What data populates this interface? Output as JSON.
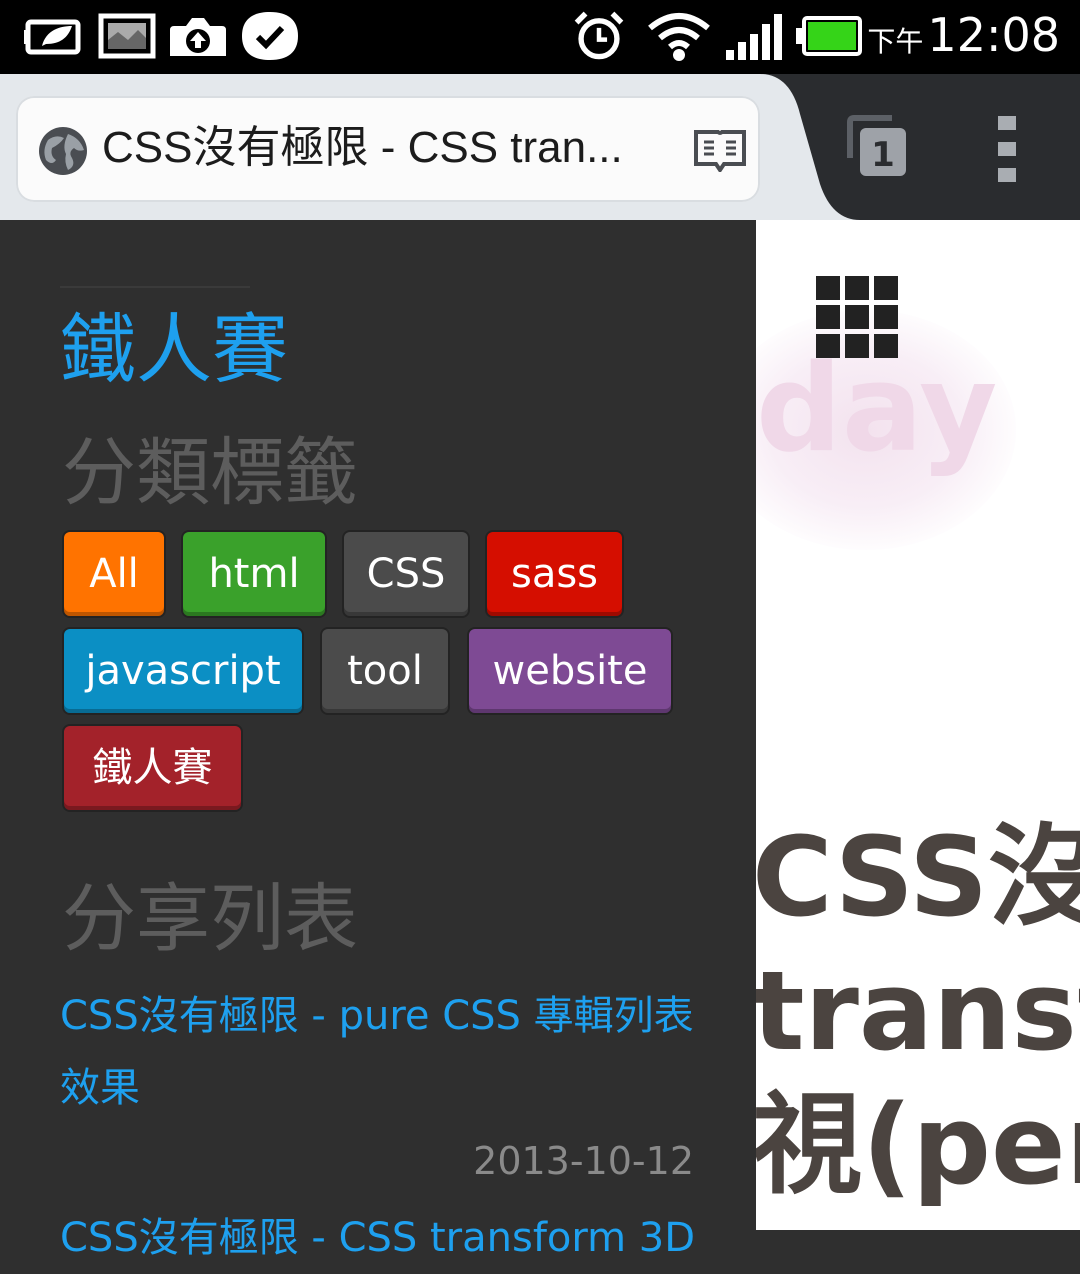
{
  "status_bar": {
    "icons": [
      "battery-saver-icon",
      "gallery-icon",
      "upload-icon",
      "task-check-icon",
      "alarm-icon",
      "wifi-icon",
      "signal-icon",
      "battery-icon"
    ],
    "ampm": "下午",
    "time": "12:08"
  },
  "browser": {
    "page_title": "CSS沒有極限 - CSS tran...",
    "tab_count": "1"
  },
  "sidebar": {
    "heading": "鐵人賽",
    "categories_title": "分類標籤",
    "tags": [
      {
        "label": "All",
        "color": "#ff7300"
      },
      {
        "label": "html",
        "color": "#3aa12b"
      },
      {
        "label": "CSS",
        "color": "#4b4b4b"
      },
      {
        "label": "sass",
        "color": "#d50e00"
      },
      {
        "label": "javascript",
        "color": "#0b8fc4"
      },
      {
        "label": "tool",
        "color": "#4b4b4b"
      },
      {
        "label": "website",
        "color": "#7e4a94"
      },
      {
        "label": "鐵人賽",
        "color": "#a3222a"
      }
    ],
    "share_title": "分享列表",
    "posts": [
      {
        "title_line1": "CSS沒有極限 - pure CSS 專輯列表",
        "title_line2": "效果",
        "date": "2013-10-12"
      },
      {
        "title_line1": "CSS沒有極限 - CSS transform 3D"
      }
    ]
  },
  "content": {
    "title_line1": "CSS沒有",
    "title_line2": "transf",
    "title_line3": "視(per",
    "watermark": "day"
  },
  "colors": {
    "accent_link": "#1ea0ef",
    "sidebar_bg": "#2f2f2f",
    "toolbar_bg": "#2a2c2f"
  }
}
